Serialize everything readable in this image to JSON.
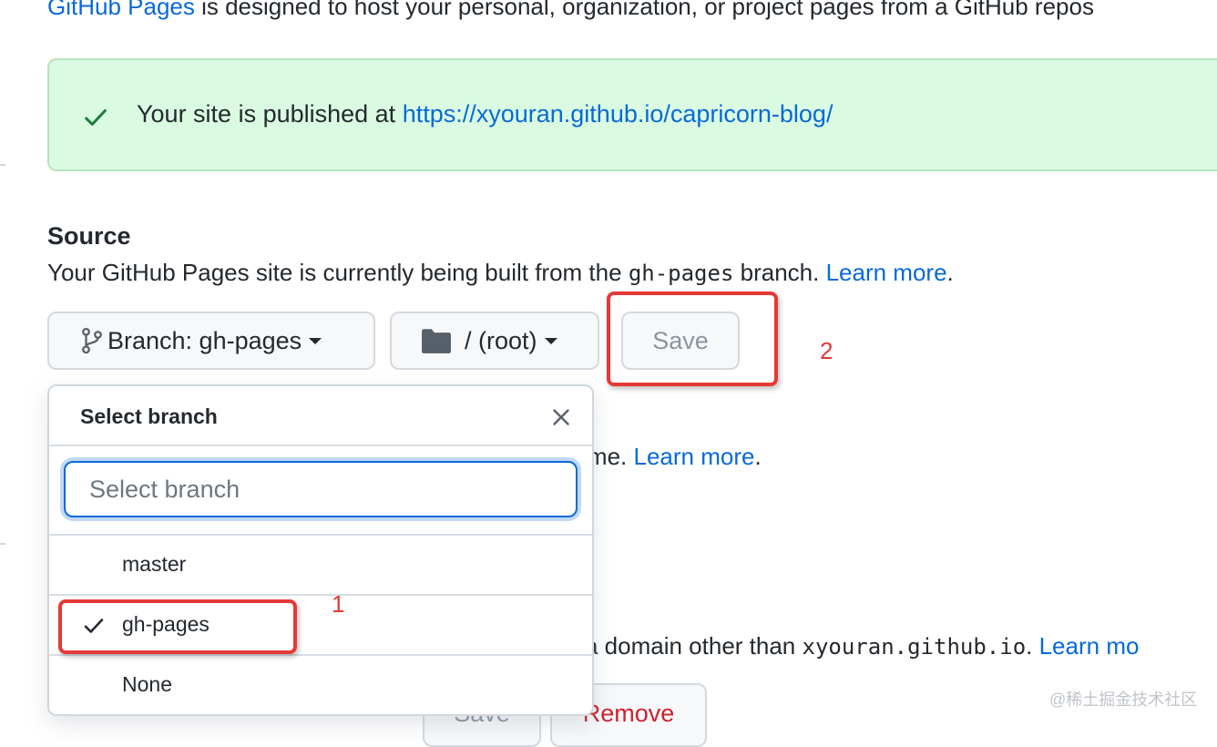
{
  "intro": {
    "link": "GitHub Pages",
    "text": " is designed to host your personal, organization, or project pages from a GitHub repos"
  },
  "flash": {
    "text": "Your site is published at ",
    "url": "https://xyouran.github.io/capricorn-blog/"
  },
  "source": {
    "title": "Source",
    "desc_before": "Your GitHub Pages site is currently being built from the ",
    "branch_code": "gh-pages",
    "desc_after": " branch. ",
    "learn_more": "Learn more",
    "period": "."
  },
  "buttons": {
    "branch": "Branch: gh-pages",
    "folder": "/ (root)",
    "save": "Save"
  },
  "behind": {
    "theme_text": "ll theme. ",
    "theme_link": "Learn more",
    "theme_period": ".",
    "domain_text": "rom a domain other than ",
    "domain_code": "xyouran.github.io",
    "domain_after": ". ",
    "domain_link": "Learn mo",
    "save2": "Save",
    "remove": "Remove"
  },
  "menu": {
    "title": "Select branch",
    "filter_placeholder": "Select branch",
    "items": [
      {
        "label": "master",
        "selected": false
      },
      {
        "label": "gh-pages",
        "selected": true
      },
      {
        "label": "None",
        "selected": false
      }
    ]
  },
  "annotations": {
    "one": "1",
    "two": "2"
  },
  "watermark": "@稀土掘金技术社区",
  "colors": {
    "link": "#0969da",
    "success_bg": "#dafbe1",
    "success_icon": "#1a7f37",
    "annotation": "#e53935"
  }
}
